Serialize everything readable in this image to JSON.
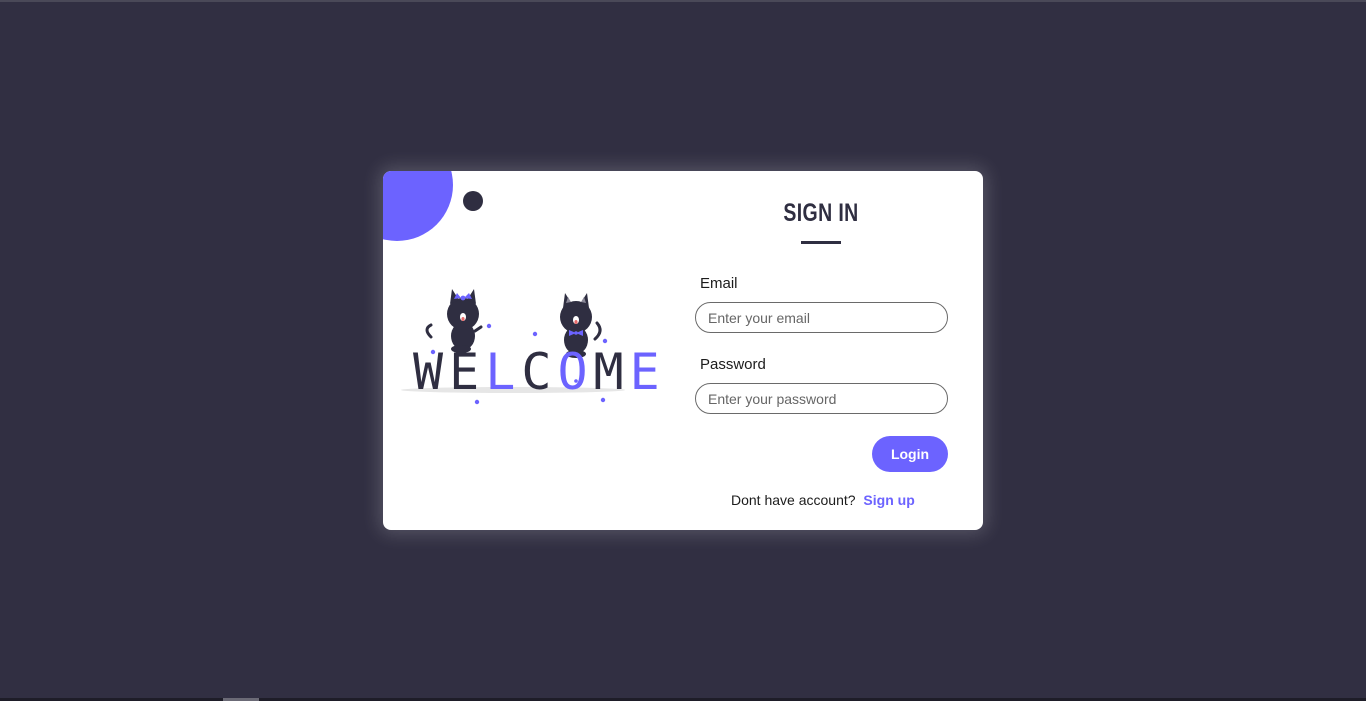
{
  "theme": {
    "background": "#312f42",
    "accent": "#6c63ff",
    "dark": "#2f2e41",
    "card": "#ffffff"
  },
  "illustration": {
    "welcome_letters": [
      {
        "char": "W",
        "color": "dark"
      },
      {
        "char": "E",
        "color": "dark"
      },
      {
        "char": "L",
        "color": "purple"
      },
      {
        "char": "C",
        "color": "dark"
      },
      {
        "char": "O",
        "color": "purple"
      },
      {
        "char": "M",
        "color": "dark"
      },
      {
        "char": "E",
        "color": "purple"
      }
    ],
    "icons": [
      "cat-left-icon",
      "cat-right-icon"
    ]
  },
  "form": {
    "title": "SIGN IN",
    "email_label": "Email",
    "email_placeholder": "Enter your email",
    "email_value": "",
    "password_label": "Password",
    "password_placeholder": "Enter your password",
    "password_value": "",
    "login_label": "Login",
    "signup_prompt": "Dont have account?",
    "signup_link": "Sign up"
  }
}
